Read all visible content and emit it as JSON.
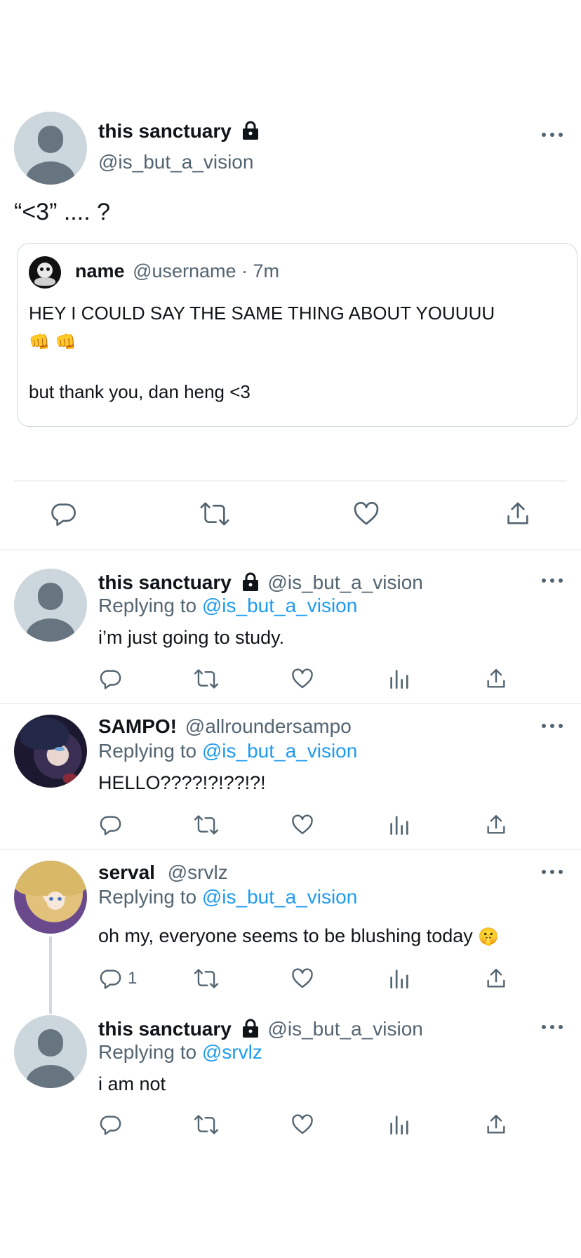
{
  "main_tweet": {
    "author_name": "this sanctuary",
    "author_handle": "@is_but_a_vision",
    "text": "“<3” .... ?",
    "quote": {
      "name": "name",
      "handle_time": "@username · 7m",
      "line1": "HEY I COULD SAY THE SAME THING ABOUT YOUUUU",
      "emoji": "👊 👊",
      "line2": "but thank you, dan heng <3"
    }
  },
  "replies": [
    {
      "name": "this sanctuary",
      "handle": "@is_but_a_vision",
      "replying_prefix": "Replying to",
      "replying_to": "@is_but_a_vision",
      "text": "i’m just going to study.",
      "reply_count": ""
    },
    {
      "name": "SAMPO!",
      "handle": "@allroundersampo",
      "replying_prefix": "Replying to",
      "replying_to": "@is_but_a_vision",
      "text": "HELLO????!?!??!?!",
      "reply_count": ""
    },
    {
      "name": "serval",
      "handle": "@srvlz",
      "replying_prefix": "Replying to",
      "replying_to": "@is_but_a_vision",
      "text": "oh my, everyone seems to be blushing today",
      "emoji": "🤫",
      "reply_count": "1"
    },
    {
      "name": "this sanctuary",
      "handle": "@is_but_a_vision",
      "replying_prefix": "Replying to",
      "replying_to": "@srvlz",
      "text": "i am not",
      "reply_count": ""
    }
  ],
  "colors": {
    "accent": "#1d9bf0",
    "text": "#0f1419",
    "secondary": "#536471",
    "border": "#cfd9de"
  }
}
